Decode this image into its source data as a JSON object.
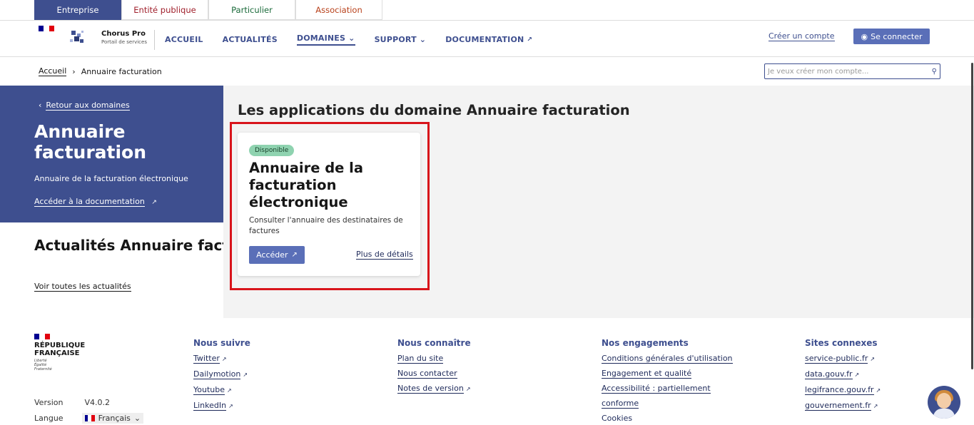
{
  "tabs": [
    "Entreprise",
    "Entité publique",
    "Particulier",
    "Association"
  ],
  "logo": {
    "rf": "RÉPUBLIQUE FRANÇAISE",
    "motto": "Liberté Égalité Fraternité"
  },
  "brand": {
    "name": "Chorus Pro",
    "sub": "Portail de services"
  },
  "nav": [
    "ACCUEIL",
    "ACTUALITÉS",
    "DOMAINES",
    "SUPPORT",
    "DOCUMENTATION"
  ],
  "header": {
    "create_account": "Créer un compte",
    "login": "Se connecter"
  },
  "breadcrumb": {
    "home": "Accueil",
    "current": "Annuaire facturation"
  },
  "search": {
    "placeholder": "Je veux créer mon compte..."
  },
  "sidebar": {
    "back": "Retour aux domaines",
    "title": "Annuaire facturation",
    "desc": "Annuaire de la facturation électronique",
    "doc_link": "Accéder à la documentation",
    "news_title": "Actualités Annuaire facturation",
    "news_link": "Voir toutes les actualités"
  },
  "main": {
    "title": "Les applications du domaine Annuaire facturation",
    "card": {
      "badge": "Disponible",
      "title": "Annuaire de la facturation électronique",
      "desc": "Consulter l'annuaire des destinataires de factures",
      "button": "Accéder",
      "details": "Plus de détails"
    }
  },
  "footer": {
    "version_label": "Version",
    "version": "V4.0.2",
    "lang_label": "Langue",
    "lang": "Français",
    "columns": [
      {
        "title": "Nous suivre",
        "links": [
          "Twitter",
          "Dailymotion",
          "Youtube",
          "LinkedIn"
        ]
      },
      {
        "title": "Nous connaître",
        "links": [
          "Plan du site",
          "Nous contacter",
          "Notes de version"
        ]
      },
      {
        "title": "Nos engagements",
        "links": [
          "Conditions générales d'utilisation",
          "Engagement et qualité",
          "Accessibilité : partiellement",
          "conforme",
          "Cookies"
        ]
      },
      {
        "title": "Sites connexes",
        "links": [
          "service-public.fr",
          "data.gouv.fr",
          "legifrance.gouv.fr",
          "gouvernement.fr"
        ]
      }
    ]
  },
  "colors": {
    "primary": "#3e4f8f",
    "button": "#5a6fb8",
    "badge": "#8fd3b0",
    "highlight": "#d8141b"
  }
}
